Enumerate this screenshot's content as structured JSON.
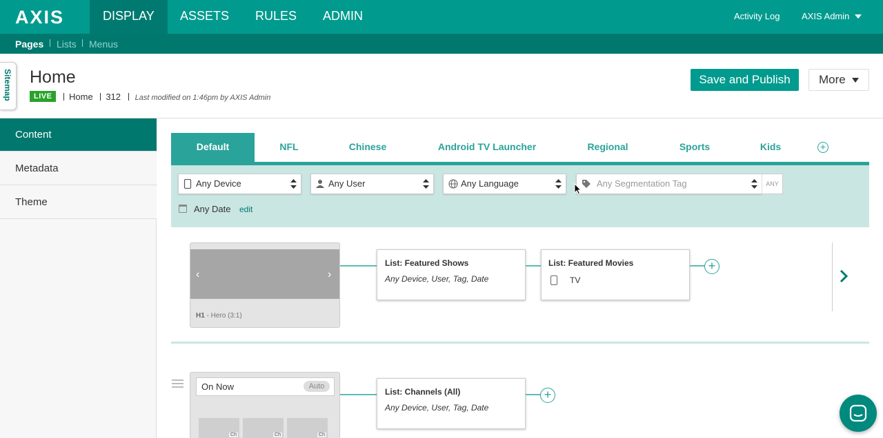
{
  "topnav": {
    "logo": "AXIS",
    "items": [
      {
        "label": "DISPLAY",
        "active": true
      },
      {
        "label": "ASSETS"
      },
      {
        "label": "RULES"
      },
      {
        "label": "ADMIN"
      }
    ],
    "activity_log": "Activity Log",
    "user": "AXIS Admin"
  },
  "subnav": {
    "items": [
      {
        "label": "Pages",
        "active": true
      },
      {
        "label": "Lists"
      },
      {
        "label": "Menus"
      }
    ]
  },
  "sitemap_tab": "Sitemap",
  "page": {
    "title": "Home",
    "status": "LIVE",
    "name": "Home",
    "id": "312",
    "modified": "Last modified on 1:46pm by AXIS Admin",
    "save_button": "Save and Publish",
    "more_button": "More"
  },
  "leftnav": {
    "items": [
      {
        "label": "Content",
        "active": true
      },
      {
        "label": "Metadata"
      },
      {
        "label": "Theme"
      }
    ]
  },
  "tabs": [
    {
      "label": "Default",
      "active": true
    },
    {
      "label": "NFL"
    },
    {
      "label": "Chinese"
    },
    {
      "label": "Android TV Launcher"
    },
    {
      "label": "Regional"
    },
    {
      "label": "Sports"
    },
    {
      "label": "Kids"
    }
  ],
  "filters": {
    "device": "Any Device",
    "user": "Any User",
    "language": "Any Language",
    "segmentation_placeholder": "Any Segmentation Tag",
    "any_toggle": "ANY",
    "date": "Any Date",
    "edit": "edit"
  },
  "row1": {
    "hero_code": "H1",
    "hero_label": " - Hero (3:1)",
    "lists": [
      {
        "title": "List: Featured Shows",
        "subtitle": "Any Device, User, Tag, Date"
      },
      {
        "title": "List: Featured Movies",
        "device": "TV"
      }
    ]
  },
  "row2": {
    "name": "On Now",
    "auto": "Auto",
    "thumb_label": "Ch",
    "lists": [
      {
        "title": "List: Channels (All)",
        "subtitle": "Any Device, User, Tag, Date"
      }
    ]
  },
  "colors": {
    "primary": "#009b8e",
    "primary_dark": "#00786e",
    "accent": "#2aa39a",
    "filter_bg": "#cae6e3",
    "live_badge": "#2aa22a"
  }
}
